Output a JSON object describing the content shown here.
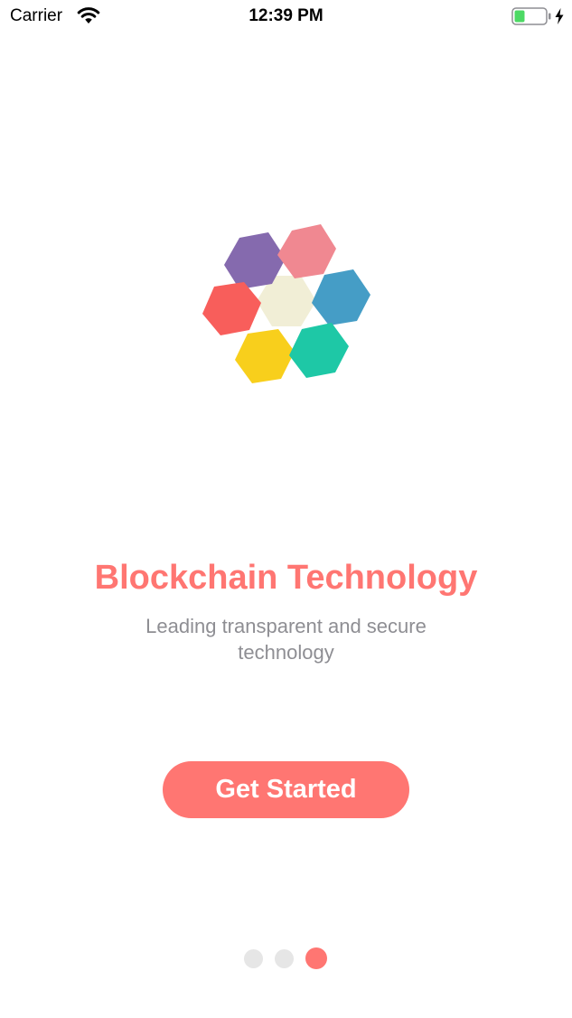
{
  "status_bar": {
    "carrier": "Carrier",
    "time": "12:39 PM"
  },
  "onboarding": {
    "title": "Blockchain Technology",
    "subtitle": "Leading transparent and secure technology",
    "button_label": "Get Started",
    "pages": 3,
    "current_page": 3
  },
  "colors": {
    "accent": "#ff7672",
    "dot_inactive": "#e6e6e6",
    "battery_fill": "#4cd964",
    "logo_center": "#f1eed6",
    "logo_purple": "#856aae",
    "logo_pink": "#f08891",
    "logo_blue": "#459dc6",
    "logo_red": "#f85e5b",
    "logo_yellow": "#f8cf1c",
    "logo_teal": "#1ec8a6"
  },
  "icons": {
    "wifi": "wifi-icon",
    "battery": "battery-icon",
    "charging": "charging-bolt-icon",
    "logo": "hexagon-cluster-logo"
  }
}
